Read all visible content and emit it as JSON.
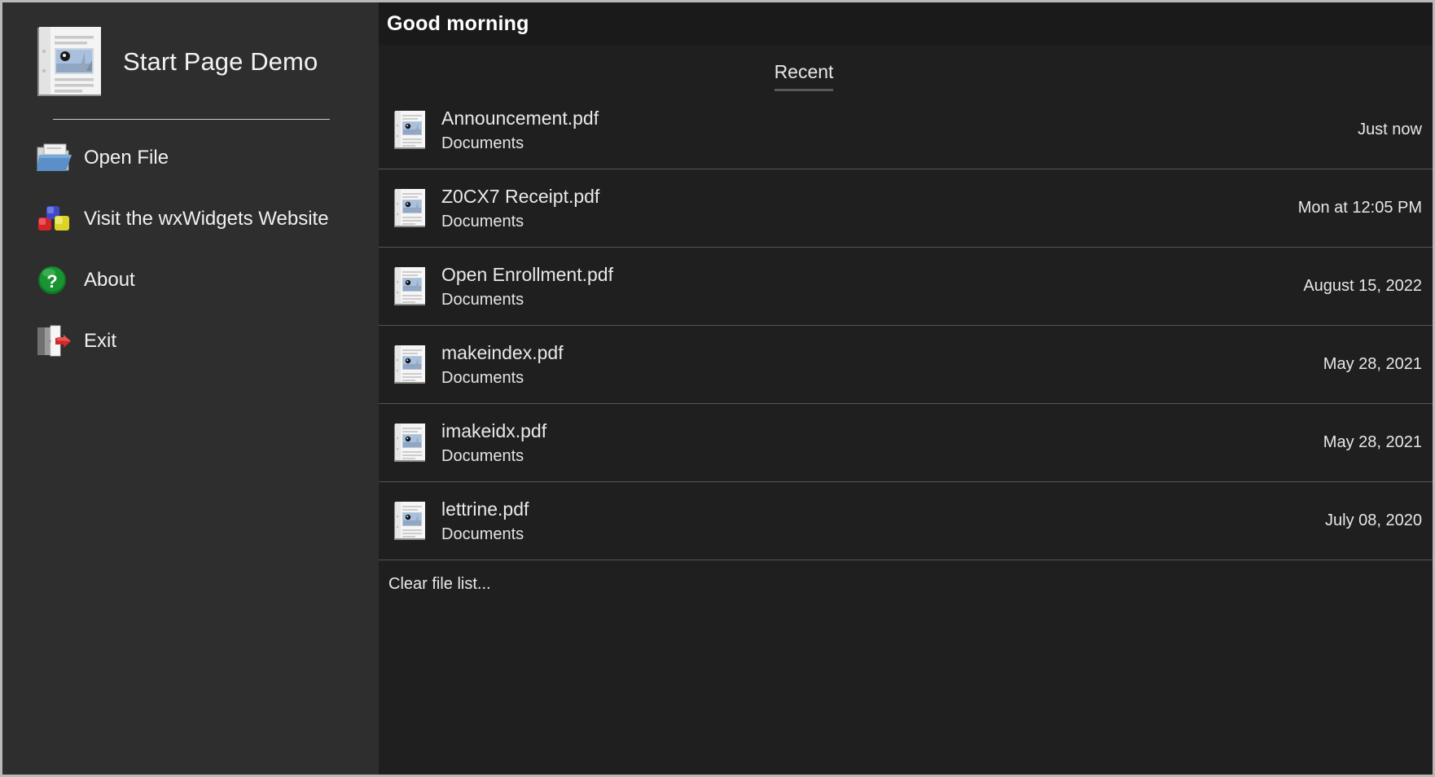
{
  "app": {
    "title": "Start Page Demo",
    "logo_icon": "document-page-icon"
  },
  "sidebar": {
    "items": [
      {
        "label": "Open File",
        "icon": "open-folder-icon"
      },
      {
        "label": "Visit the wxWidgets Website",
        "icon": "wxwidgets-blocks-icon"
      },
      {
        "label": "About",
        "icon": "green-question-help-icon"
      },
      {
        "label": "Exit",
        "icon": "door-exit-arrow-icon"
      }
    ]
  },
  "main": {
    "greeting": "Good morning",
    "tabs": [
      {
        "label": "Recent",
        "selected": true
      }
    ],
    "recent_files": [
      {
        "name": "Announcement.pdf",
        "location": "Documents",
        "time": "Just now",
        "icon": "pdf-document-icon"
      },
      {
        "name": "Z0CX7 Receipt.pdf",
        "location": "Documents",
        "time": "Mon at 12:05 PM",
        "icon": "pdf-document-icon"
      },
      {
        "name": "Open Enrollment.pdf",
        "location": "Documents",
        "time": "August 15, 2022",
        "icon": "pdf-document-icon"
      },
      {
        "name": "makeindex.pdf",
        "location": "Documents",
        "time": "May 28, 2021",
        "icon": "pdf-document-icon"
      },
      {
        "name": "imakeidx.pdf",
        "location": "Documents",
        "time": "May 28, 2021",
        "icon": "pdf-document-icon"
      },
      {
        "name": "lettrine.pdf",
        "location": "Documents",
        "time": "July 08, 2020",
        "icon": "pdf-document-icon"
      }
    ],
    "clear_link": "Clear file list..."
  },
  "colors": {
    "sidebar_bg": "#2e2e2e",
    "content_bg": "#1f1f1f",
    "greeting_bg": "#1a1a1a",
    "text": "#e9e9e9",
    "divider": "#555555",
    "tab_underline": "#5a5a5a",
    "window_border": "#b9b9b9"
  }
}
